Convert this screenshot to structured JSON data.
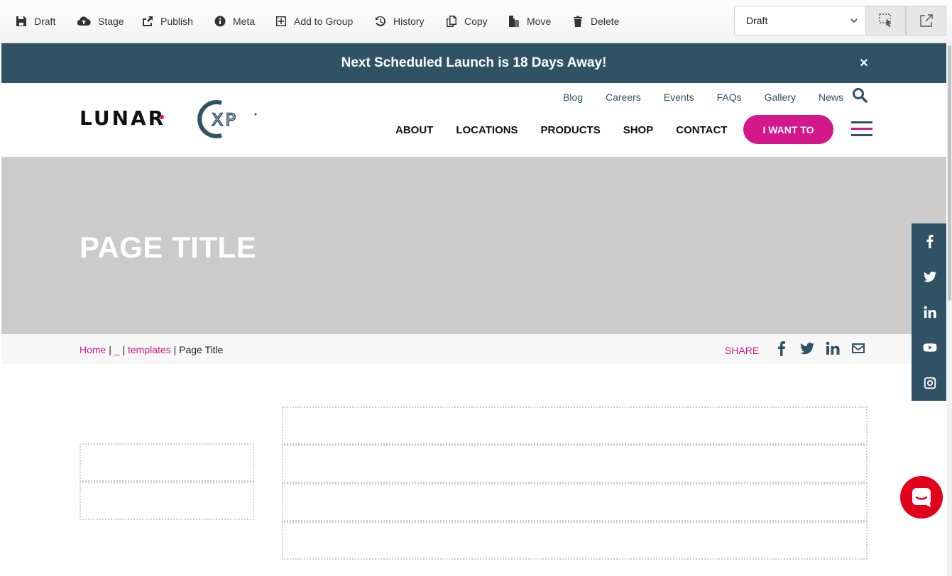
{
  "toolbar": {
    "items": [
      {
        "label": "Draft",
        "icon": "save-icon"
      },
      {
        "label": "Stage",
        "icon": "cloud-upload-icon"
      },
      {
        "label": "Publish",
        "icon": "share-out-icon"
      },
      {
        "label": "Meta",
        "icon": "info-icon"
      },
      {
        "label": "Add to Group",
        "icon": "plus-square-icon"
      },
      {
        "label": "History",
        "icon": "history-icon"
      },
      {
        "label": "Copy",
        "icon": "copy-icon"
      },
      {
        "label": "Move",
        "icon": "move-icon"
      },
      {
        "label": "Delete",
        "icon": "trash-icon"
      }
    ],
    "status_select": {
      "value": "Draft"
    }
  },
  "banner": {
    "text": "Next Scheduled Launch is 18 Days Away!",
    "close": "×"
  },
  "brand": {
    "logo_text": "LUNAR XP",
    "accent": "#d4178a",
    "primary": "#2f5364"
  },
  "util_nav": [
    "Blog",
    "Careers",
    "Events",
    "FAQs",
    "Gallery",
    "News"
  ],
  "main_nav": [
    "ABOUT",
    "LOCATIONS",
    "PRODUCTS",
    "SHOP",
    "CONTACT"
  ],
  "cta": "I WANT TO",
  "hero": {
    "title": "PAGE TITLE"
  },
  "breadcrumb": {
    "home": "Home",
    "sep1": " | ",
    "underscore": "_",
    "sep2": " | ",
    "templates": "templates",
    "sep3": " | ",
    "current": "Page Title"
  },
  "share": {
    "label": "SHARE",
    "icons": [
      "facebook-icon",
      "twitter-icon",
      "linkedin-icon",
      "email-icon"
    ]
  },
  "social_sidebar": [
    "facebook-icon",
    "twitter-icon",
    "linkedin-icon",
    "youtube-icon",
    "instagram-icon"
  ]
}
